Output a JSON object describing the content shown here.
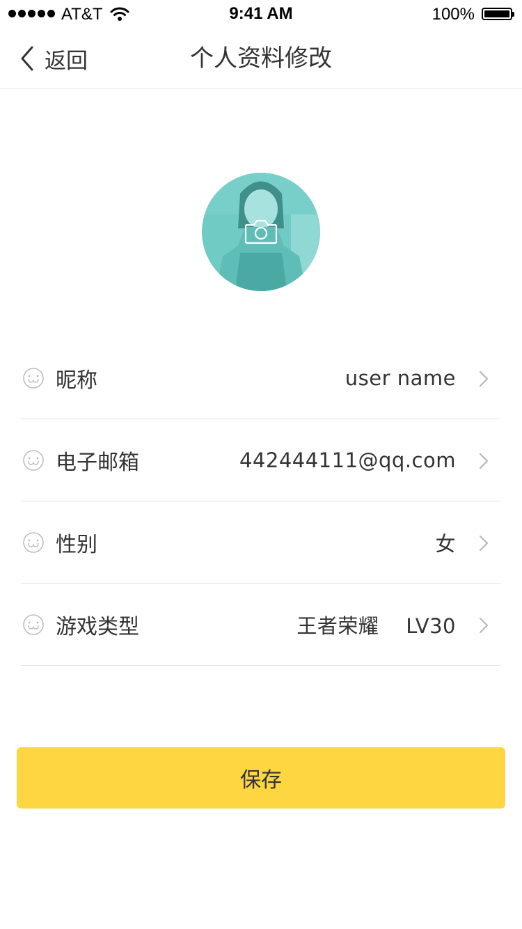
{
  "status_bar": {
    "carrier": "AT&T",
    "time": "9:41 AM",
    "battery": "100%"
  },
  "nav": {
    "back_label": "返回",
    "title": "个人资料修改"
  },
  "avatar": {
    "icon": "camera-icon"
  },
  "form": {
    "rows": [
      {
        "label": "昵称",
        "value": "user name"
      },
      {
        "label": "电子邮箱",
        "value": "442444111@qq.com"
      },
      {
        "label": "性别",
        "value": "女"
      },
      {
        "label": "游戏类型",
        "value": "王者荣耀    LV30"
      }
    ]
  },
  "save": {
    "label": "保存"
  },
  "colors": {
    "accent": "#fdd641",
    "avatar_tint": "#6fcbc6",
    "divider": "#e5e5e5",
    "text": "#333333",
    "icon_gray": "#bdbdbd"
  }
}
